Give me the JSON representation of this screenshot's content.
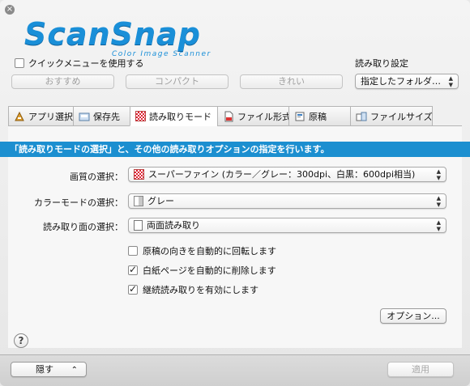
{
  "window": {
    "close_glyph": "×"
  },
  "logo": {
    "name": "ScanSnap",
    "subtitle": "Color Image Scanner",
    "color": "#1a8fd8"
  },
  "quick_menu": {
    "checkbox_label": "クイックメニューを使用する",
    "checked": false,
    "buttons": [
      "おすすめ",
      "コンパクト",
      "きれい"
    ]
  },
  "scan_settings": {
    "label": "読み取り設定",
    "selected": "指定したフォルダ…"
  },
  "tabs": [
    {
      "label": "アプリ選択",
      "icon": "app-select-icon"
    },
    {
      "label": "保存先",
      "icon": "save-destination-icon"
    },
    {
      "label": "読み取りモード",
      "icon": "scan-mode-icon",
      "active": true
    },
    {
      "label": "ファイル形式",
      "icon": "file-format-icon"
    },
    {
      "label": "原稿",
      "icon": "paper-icon"
    },
    {
      "label": "ファイルサイズ",
      "icon": "file-size-icon"
    }
  ],
  "banner": {
    "text": "「読み取りモードの選択」と、その他の読み取りオプションの指定を行います。",
    "color": "#1c8fd0"
  },
  "fields": {
    "image_quality": {
      "label": "画質の選択：",
      "value": "スーパーファイン (カラー／グレー：300dpi、白黒：600dpi相当)"
    },
    "color_mode": {
      "label": "カラーモードの選択：",
      "value": "グレー"
    },
    "scan_side": {
      "label": "読み取り面の選択：",
      "value": "両面読み取り"
    }
  },
  "options": [
    {
      "label": "原稿の向きを自動的に回転します",
      "checked": false
    },
    {
      "label": "白紙ページを自動的に削除します",
      "checked": true
    },
    {
      "label": "継続読み取りを有効にします",
      "checked": true
    }
  ],
  "option_button": "オプション...",
  "help_glyph": "?",
  "footer": {
    "hide_label": "隠す",
    "hide_chevron": "⌃",
    "apply_label": "適用"
  }
}
